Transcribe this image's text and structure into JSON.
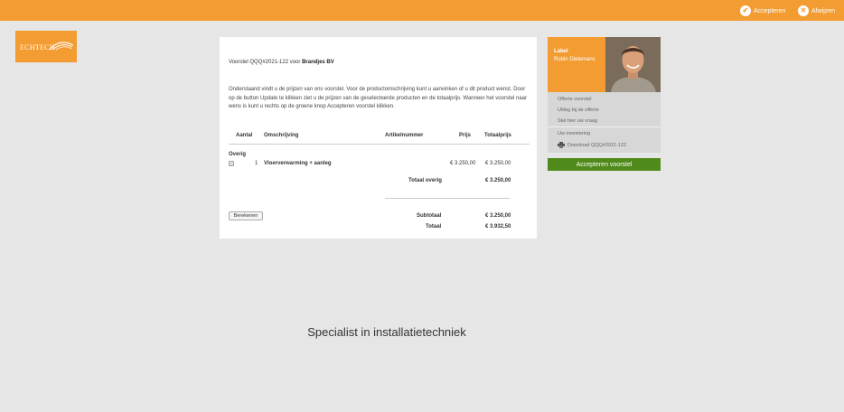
{
  "topbar": {
    "accept_label": "Accepteren",
    "reject_label": "Afwijzen",
    "color": "#f39c32"
  },
  "logo": {
    "text": "ECHTECH"
  },
  "proposal": {
    "intro_prefix": "Voorstel QQQ#2021-122 voor",
    "client": "Brandjes BV",
    "description": "Onderstaand vindt u de prijzen van ons voorstel. Voor de productomschrijving kunt u aanvinken of u dit product wenst. Door op de button Update te klikken ziet u de prijzen van de geselecteerde producten en de totaalprijs. Wanneer het voorstel naar wens is kunt u rechts op de groene knop Accepteren voorstel klikken.",
    "headers": {
      "qty": "Aantal",
      "desc": "Omschrijving",
      "article": "Artikelnummer",
      "price": "Prijs",
      "total": "Totaalprijs"
    },
    "group": "Overig",
    "line": {
      "qty": "1",
      "desc": "Vloerverwarming + aanleg",
      "price": "€ 3.250,00",
      "total": "€ 3.250,00"
    },
    "group_total_label": "Totaal overig",
    "group_total": "€ 3.250,00",
    "calc_button": "Berekenen",
    "subtotal_label": "Subtotaal",
    "subtotal": "€ 3.250,00",
    "total_label": "Totaal",
    "total": "€ 3.932,50"
  },
  "sidebar": {
    "label": "Label",
    "name": "Robin Dielemans",
    "menu": [
      "Offerte voorstel",
      "Uitleg bij de offerte",
      "Stel hier uw vraag",
      "Uw investering"
    ],
    "download": "Download QQQ#2021-122",
    "accept_button": "Accepteren voorstel",
    "accept_color": "#4f8a1a"
  },
  "footer": {
    "tagline": "Specialist in installatietechniek"
  }
}
